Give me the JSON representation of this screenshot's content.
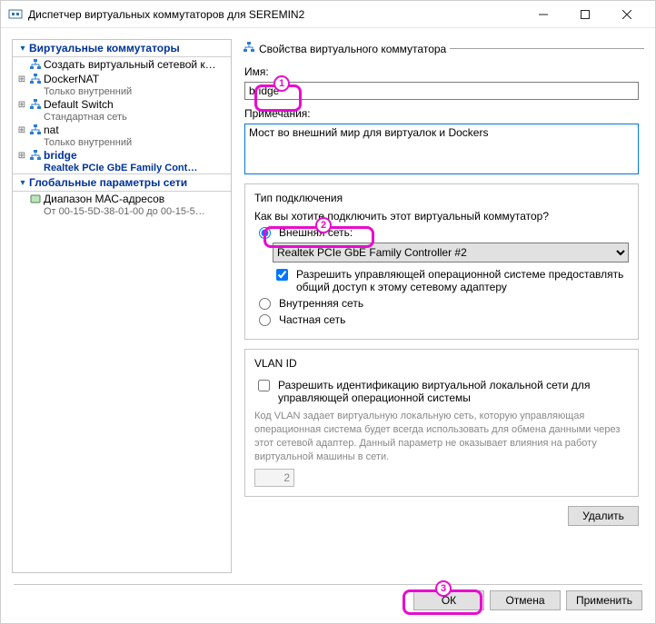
{
  "window": {
    "title": "Диспетчер виртуальных коммутаторов для SEREMIN2"
  },
  "sidebar": {
    "sections": [
      {
        "title": "Виртуальные коммутаторы"
      },
      {
        "title": "Глобальные параметры сети"
      }
    ],
    "items": [
      {
        "label": "Создать виртуальный сетевой к…",
        "sub": ""
      },
      {
        "label": "DockerNAT",
        "sub": "Только внутренний"
      },
      {
        "label": "Default Switch",
        "sub": "Стандартная сеть"
      },
      {
        "label": "nat",
        "sub": "Только внутренний"
      },
      {
        "label": "bridge",
        "sub": "Realtek PCIe GbE Family Cont…"
      }
    ],
    "global": {
      "label": "Диапазон МАС-адресов",
      "sub": "От 00-15-5D-38-01-00 до 00-15-5…"
    }
  },
  "props": {
    "legend": "Свойства виртуального коммутатора",
    "name_label": "Имя:",
    "name_value": "bridge",
    "notes_label": "Примечания:",
    "notes_value": "Мост во внешний мир для виртуалок и Dockers",
    "conn": {
      "group_title": "Тип подключения",
      "question": "Как вы хотите подключить этот виртуальный коммутатор?",
      "external": "Внешняя сеть:",
      "adapter_options": [
        "Realtek PCIe GbE Family Controller #2"
      ],
      "allow_mgmt": "Разрешить управляющей операционной системе предоставлять общий доступ к этому сетевому адаптеру",
      "internal": "Внутренняя сеть",
      "private": "Частная сеть"
    },
    "vlan": {
      "group_title": "VLAN ID",
      "enable": "Разрешить идентификацию виртуальной локальной сети для управляющей операционной системы",
      "help": "Код VLAN задает виртуальную локальную сеть, которую управляющая операционная система будет всегда использовать для обмена данными через этот сетевой адаптер. Данный параметр не оказывает влияния на работу виртуальной машины в сети.",
      "value": "2"
    },
    "delete_btn": "Удалить"
  },
  "footer": {
    "ok": "ОК",
    "cancel": "Отмена",
    "apply": "Применить"
  },
  "annotations": [
    "1",
    "2",
    "3"
  ]
}
